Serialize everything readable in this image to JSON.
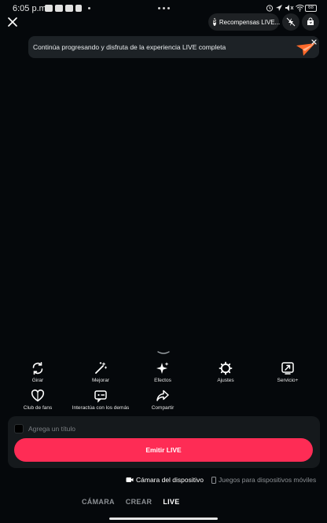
{
  "status_bar": {
    "time": "6:05 p.m.",
    "battery": "68"
  },
  "header": {
    "rewards_label": "Recompensas LIVE..."
  },
  "banner": {
    "text": "Continúa progresando y disfruta de la experiencia LIVE completa"
  },
  "tools": [
    {
      "label": "Girar",
      "icon": "rotate-icon"
    },
    {
      "label": "Mejorar",
      "icon": "magic-wand-icon"
    },
    {
      "label": "Efectos",
      "icon": "sparkle-icon"
    },
    {
      "label": "Ajustes",
      "icon": "gear-icon"
    },
    {
      "label": "Servicio+",
      "icon": "share-screen-icon"
    },
    {
      "label": "Club de fans",
      "icon": "heart-icon"
    },
    {
      "label": "Interactúa con los demás",
      "icon": "chat-game-icon"
    },
    {
      "label": "Compartir",
      "icon": "share-arrow-icon"
    }
  ],
  "panel": {
    "title_placeholder": "Agrega un título",
    "go_live_label": "Emitir LIVE"
  },
  "sources": [
    {
      "label": "Cámara del dispositivo",
      "icon": "video-camera-icon",
      "active": true
    },
    {
      "label": "Juegos para dispositivos móviles",
      "icon": "phone-icon",
      "active": false
    }
  ],
  "modes": [
    {
      "label": "CÁMARA",
      "active": false
    },
    {
      "label": "CREAR",
      "active": false
    },
    {
      "label": "LIVE",
      "active": true
    }
  ],
  "colors": {
    "background": "#05080b",
    "accent": "#fe2c55",
    "panel": "#15191c"
  }
}
